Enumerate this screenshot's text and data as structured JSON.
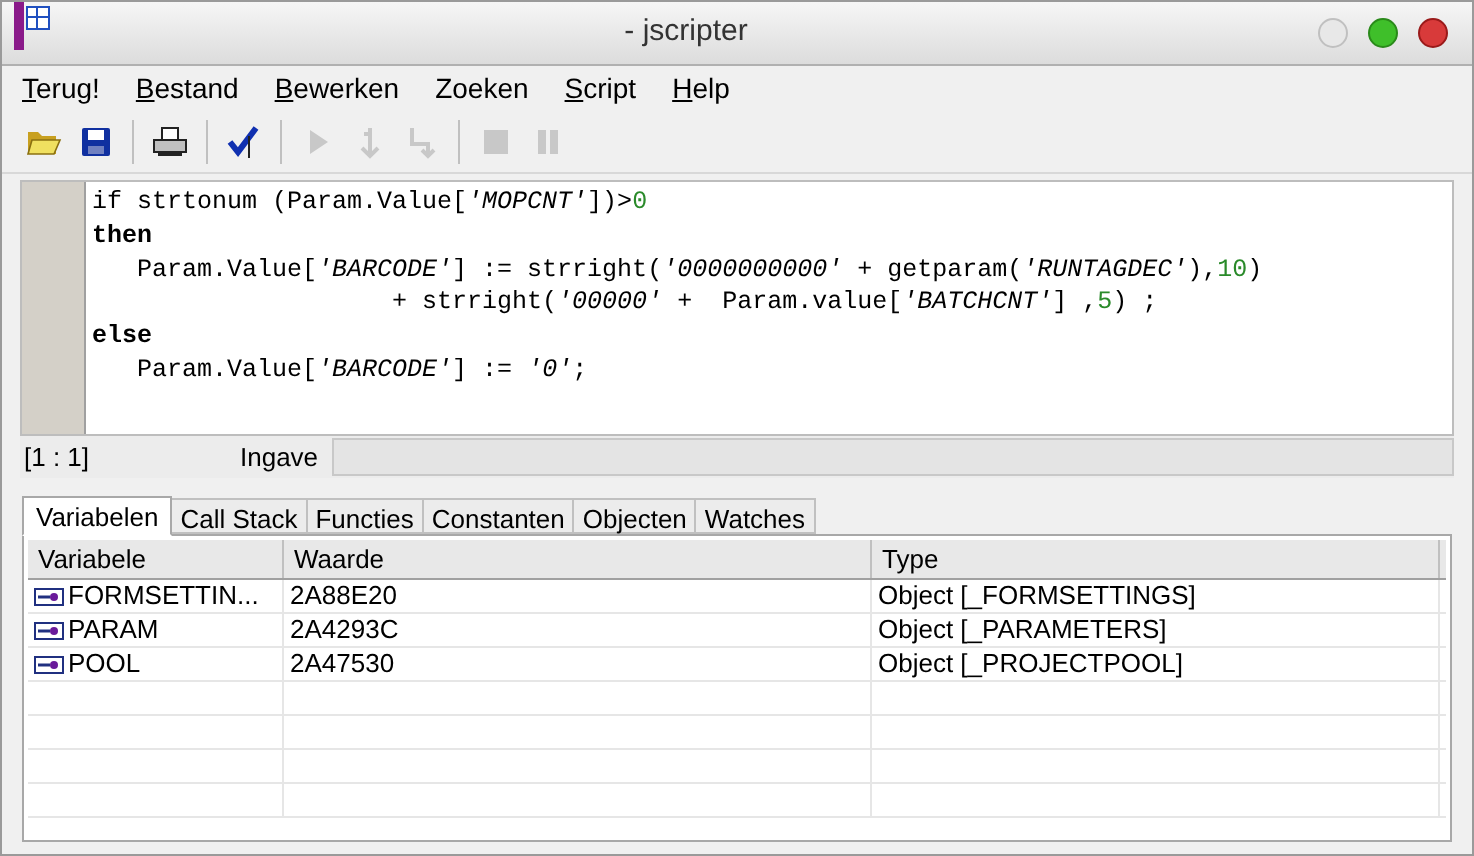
{
  "window": {
    "title": "- jscripter"
  },
  "menu": [
    {
      "label": "Terug!",
      "underlined_first": true
    },
    {
      "label": "Bestand",
      "underlined_first": true
    },
    {
      "label": "Bewerken",
      "underlined_first": true
    },
    {
      "label": "Zoeken",
      "underlined_first": false
    },
    {
      "label": "Script",
      "underlined_first": true
    },
    {
      "label": "Help",
      "underlined_first": true
    }
  ],
  "toolbar": [
    {
      "kind": "open",
      "disabled": false
    },
    {
      "kind": "save",
      "disabled": false
    },
    {
      "kind": "sep"
    },
    {
      "kind": "print",
      "disabled": false
    },
    {
      "kind": "sep"
    },
    {
      "kind": "check",
      "disabled": false
    },
    {
      "kind": "sep"
    },
    {
      "kind": "run",
      "disabled": true
    },
    {
      "kind": "stepinto",
      "disabled": true
    },
    {
      "kind": "stepover",
      "disabled": true
    },
    {
      "kind": "sep"
    },
    {
      "kind": "stop",
      "disabled": true
    },
    {
      "kind": "pause",
      "disabled": true
    }
  ],
  "editor": {
    "lines": [
      [
        {
          "kind": "plain",
          "text": "if strtonum (Param.Value["
        },
        {
          "kind": "str",
          "text": "'MOPCNT'"
        },
        {
          "kind": "plain",
          "text": "])>"
        },
        {
          "kind": "num",
          "text": "0"
        }
      ],
      [
        {
          "kind": "kw",
          "text": "then"
        }
      ],
      [
        {
          "kind": "plain",
          "text": "   Param.Value["
        },
        {
          "kind": "str",
          "text": "'BARCODE'"
        },
        {
          "kind": "plain",
          "text": "] := strright("
        },
        {
          "kind": "str",
          "text": "'0000000000'"
        },
        {
          "kind": "plain",
          "text": " + getparam("
        },
        {
          "kind": "str",
          "text": "'RUNTAGDEC'"
        },
        {
          "kind": "plain",
          "text": "),"
        },
        {
          "kind": "num",
          "text": "10"
        },
        {
          "kind": "plain",
          "text": ")"
        }
      ],
      [
        {
          "kind": "plain",
          "text": "                    + strright("
        },
        {
          "kind": "str",
          "text": "'00000'"
        },
        {
          "kind": "plain",
          "text": " +  Param.value["
        },
        {
          "kind": "str",
          "text": "'BATCHCNT'"
        },
        {
          "kind": "plain",
          "text": "] ,"
        },
        {
          "kind": "num",
          "text": "5"
        },
        {
          "kind": "plain",
          "text": ") ;"
        }
      ],
      [
        {
          "kind": "kw",
          "text": "else"
        }
      ],
      [
        {
          "kind": "plain",
          "text": "   Param.Value["
        },
        {
          "kind": "str",
          "text": "'BARCODE'"
        },
        {
          "kind": "plain",
          "text": "] := "
        },
        {
          "kind": "str",
          "text": "'0'"
        },
        {
          "kind": "plain",
          "text": ";"
        }
      ]
    ]
  },
  "status_bar": {
    "position": "[1 : 1]",
    "input_label": "Ingave"
  },
  "tabs": [
    {
      "label": "Variabelen",
      "selected": true
    },
    {
      "label": "Call Stack",
      "selected": false
    },
    {
      "label": "Functies",
      "selected": false
    },
    {
      "label": "Constanten",
      "selected": false
    },
    {
      "label": "Objecten",
      "selected": false
    },
    {
      "label": "Watches",
      "selected": false
    }
  ],
  "table": {
    "columns": [
      "Variabele",
      "Waarde",
      "Type"
    ],
    "rows": [
      [
        "FORMSETTIN...",
        "2A88E20",
        "Object [_FORMSETTINGS]"
      ],
      [
        "PARAM",
        "2A4293C",
        "Object [_PARAMETERS]"
      ],
      [
        "POOL",
        "2A47530",
        "Object [_PROJECTPOOL]"
      ]
    ]
  }
}
